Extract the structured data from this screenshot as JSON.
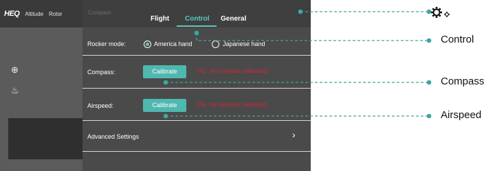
{
  "app": {
    "logo": "HEQ",
    "modes": [
      "Altitude",
      "Rotor"
    ]
  },
  "panel": {
    "ghost_text": "Compass",
    "tabs": [
      {
        "label": "Flight",
        "active": false
      },
      {
        "label": "Control",
        "active": true
      },
      {
        "label": "General",
        "active": false
      }
    ],
    "rocker": {
      "label": "Rocker mode:",
      "options": [
        {
          "label": "America hand",
          "selected": true
        },
        {
          "label": "Japanese hand",
          "selected": false
        }
      ]
    },
    "compass": {
      "label": "Compass:",
      "button": "Calibrate",
      "status": "(Tip : No compass calibrated)"
    },
    "airspeed": {
      "label": "Airspeed:",
      "button": "Calibrate",
      "status": "(Tip : No airspeed calibrated)"
    },
    "advanced": {
      "label": "Advanced Settings",
      "chevron": "›"
    }
  },
  "callouts": {
    "control": "Control",
    "compass": "Compass",
    "airspeed": "Airspeed"
  },
  "colors": {
    "accent": "#5bc8c0",
    "button": "#4fb8b0",
    "warning": "#d8262d",
    "callout": "#3aa8a0"
  }
}
